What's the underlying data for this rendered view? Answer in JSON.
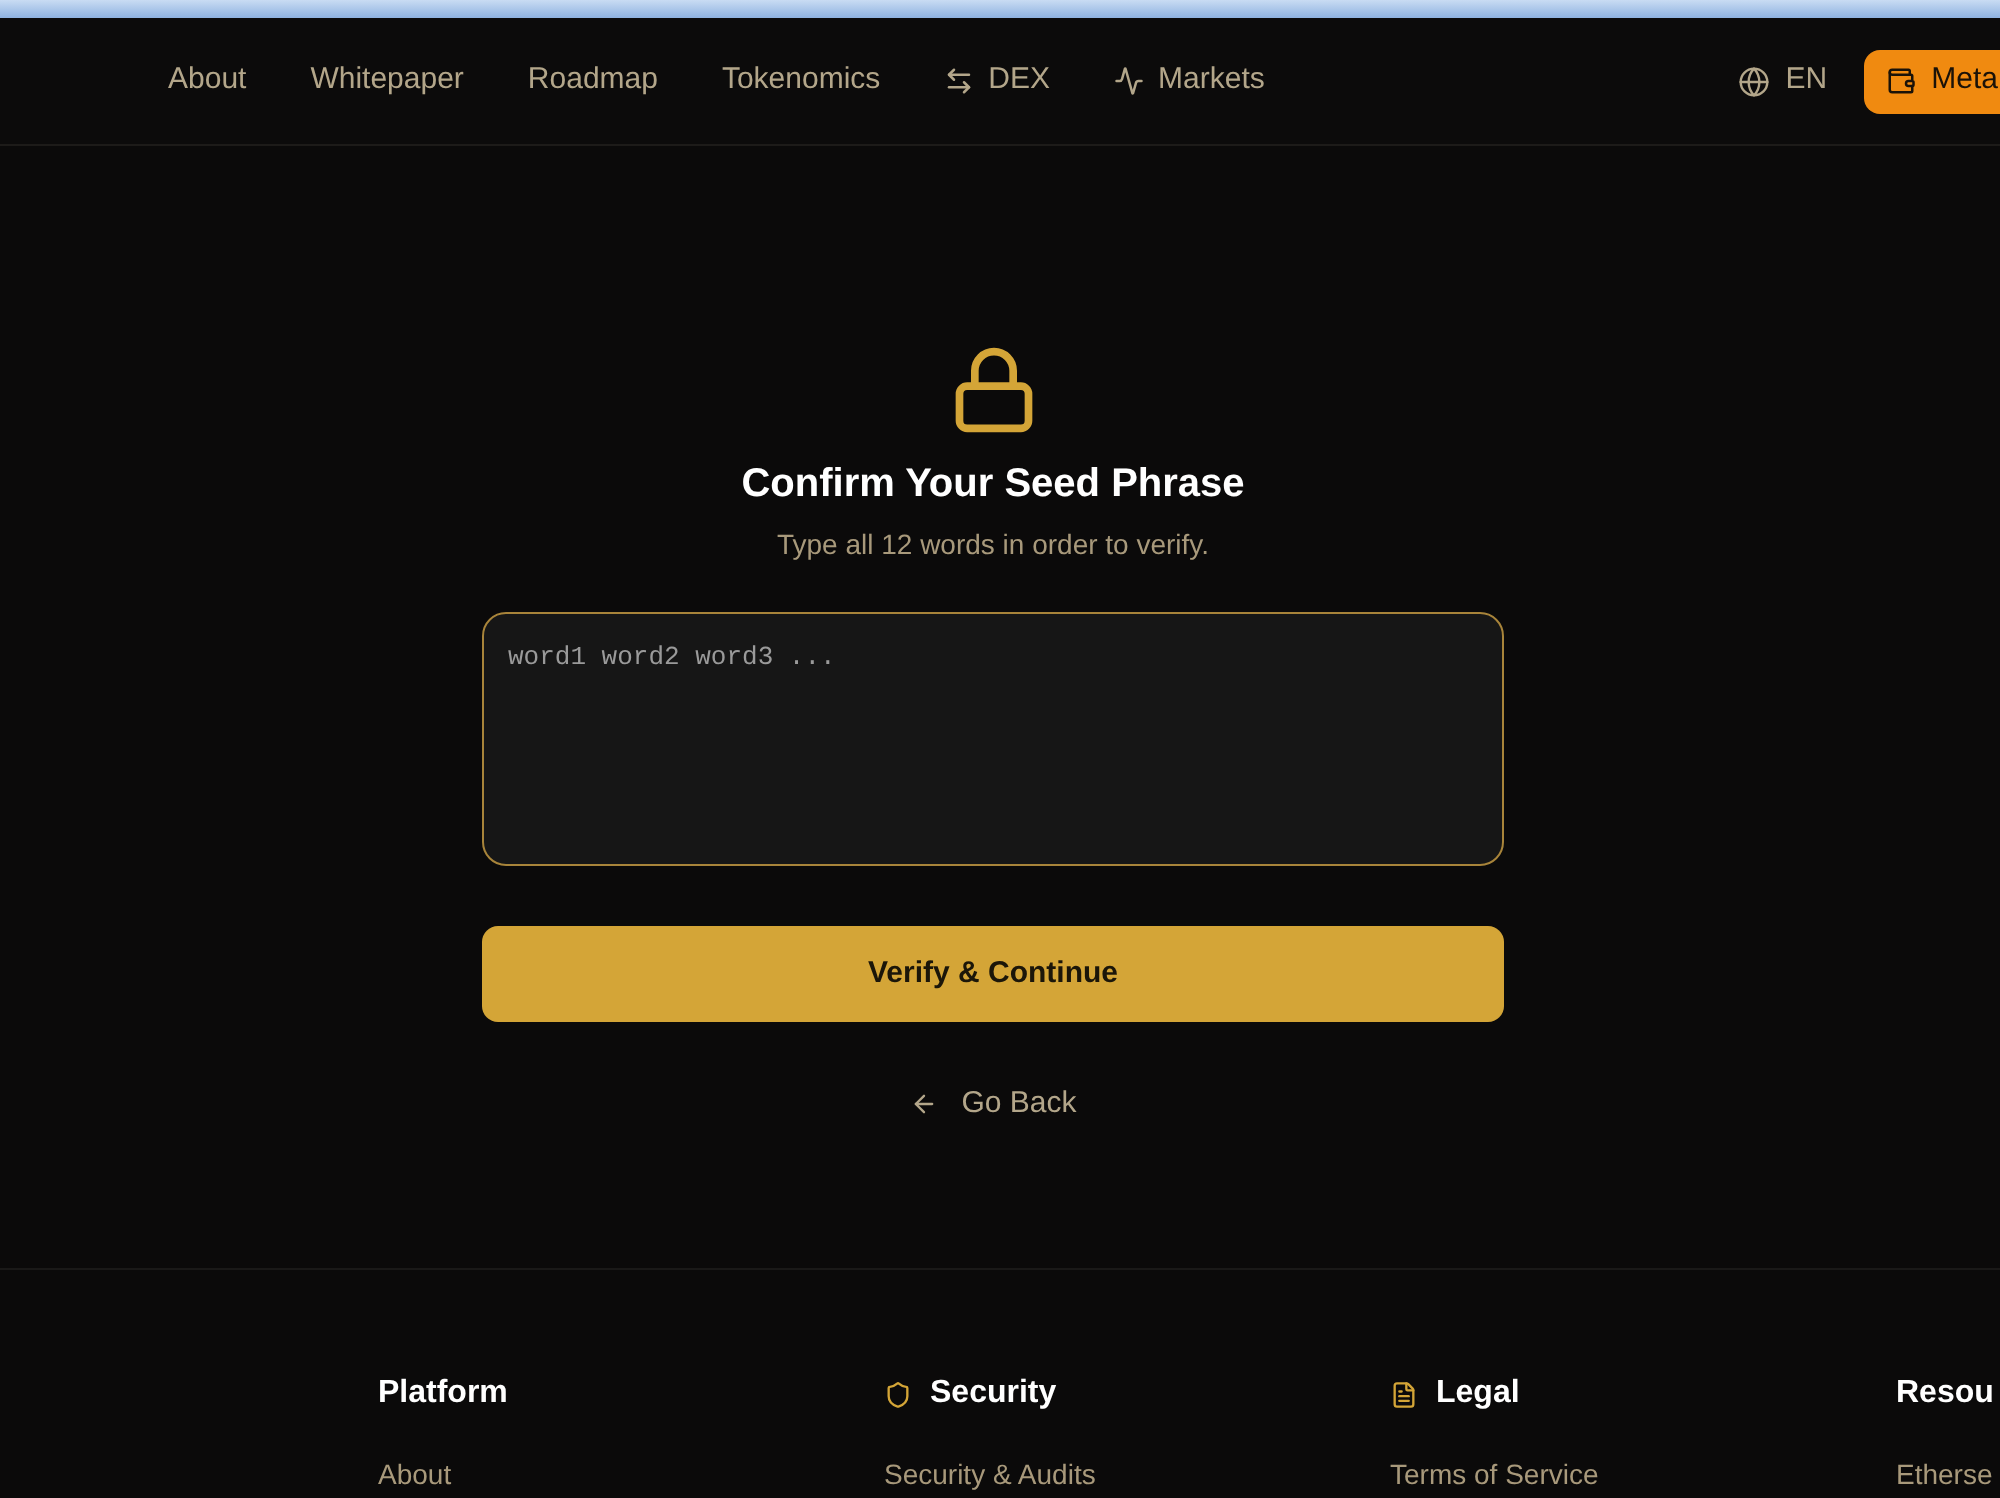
{
  "nav": {
    "links": [
      {
        "label": "About",
        "kind": "plain"
      },
      {
        "label": "Whitepaper",
        "kind": "plain"
      },
      {
        "label": "Roadmap",
        "kind": "plain"
      },
      {
        "label": "Tokenomics",
        "kind": "plain"
      },
      {
        "label": "DEX",
        "kind": "exchange"
      },
      {
        "label": "Markets",
        "kind": "markets"
      }
    ],
    "language": "EN",
    "wallet_button": "Meta"
  },
  "confirm": {
    "title": "Confirm Your Seed Phrase",
    "subtitle": "Type all 12 words in order to verify.",
    "seed_input": {
      "placeholder": "word1 word2 word3 ..."
    },
    "verify_button": "Verify & Continue",
    "back_link": "Go Back"
  },
  "footer": {
    "columns": [
      {
        "heading": "Platform",
        "kind": "plain",
        "links": [
          "About"
        ]
      },
      {
        "heading": "Security",
        "kind": "security",
        "links": [
          "Security & Audits"
        ]
      },
      {
        "heading": "Legal",
        "kind": "legal",
        "links": [
          "Terms of Service"
        ]
      },
      {
        "heading": "Resou",
        "kind": "plain",
        "links": [
          "Etherse"
        ]
      }
    ]
  }
}
